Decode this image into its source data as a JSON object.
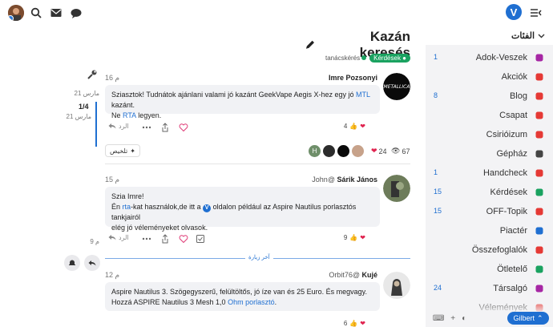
{
  "header": {
    "icons": [
      "user-avatar",
      "search-icon",
      "mail-icon",
      "chat-icon"
    ],
    "logo_letter": "V",
    "menu_icon": "menu-icon"
  },
  "topic": {
    "title": "Kazán keresés",
    "tag": "tanácskérés",
    "category": "Kérdések"
  },
  "timeline": {
    "start_date": "21 مارس",
    "position": "1/4",
    "position_date": "21 مارس",
    "end_date": "9 م"
  },
  "posts": [
    {
      "user": "Imre Pozsonyi",
      "date": "16 م",
      "text_pre": "Sziasztok! Tudnátok ajánlani valami jó kazánt GeekVape Aegis X-hez egy jó ",
      "link1": "MTL",
      "text_mid": " kazánt.",
      "text_line2_pre": "Ne ",
      "link2": "RTA",
      "text_line2_post": " legyen.",
      "reply_label": "الرد",
      "likes": "4"
    },
    {
      "user": "Sárik János",
      "handle": "John@",
      "date": "15 م",
      "line1": "Szia Imre!",
      "line2_pre": "Én ",
      "link1": "rta",
      "line2_mid": "-kat használok,de itt a ",
      "line2_post": " oldalon például az Aspire Nautilus porlasztós tankjairól",
      "line3": "elég jó véleményeket olvasok.",
      "reply_label": "الرد",
      "likes": "9"
    },
    {
      "user": "Kujé",
      "handle": "Orbit76@",
      "date": "12 م",
      "line1": "Aspire Nautilus 3. Szögegyszerű, felültöltős, jó íze van és 25 Euro. És megvagy.",
      "line2_pre": "Hozzá ASPIRE Nautilus 3 Mesh 1,0 ",
      "link1": "Ohm porlasztó",
      "line2_post": ".",
      "likes": "6"
    }
  ],
  "summary": {
    "button_label": "تلخيص",
    "likes": "24",
    "views": "67"
  },
  "last_visit_label": "آخر زيارة",
  "sidebar": {
    "heading": "الفئات",
    "items": [
      {
        "count": "1",
        "name": "Adok-Veszek",
        "color": "#a626a4"
      },
      {
        "count": "",
        "name": "Akciók",
        "color": "#e53935"
      },
      {
        "count": "8",
        "name": "Blog",
        "color": "#e53935"
      },
      {
        "count": "",
        "name": "Csapat",
        "color": "#e53935"
      },
      {
        "count": "",
        "name": "Csirióizum",
        "color": "#e53935"
      },
      {
        "count": "",
        "name": "Gépház",
        "color": "#444444"
      },
      {
        "count": "1",
        "name": "Handcheck",
        "color": "#e53935"
      },
      {
        "count": "15",
        "name": "Kérdések",
        "color": "#1aa260"
      },
      {
        "count": "15",
        "name": "OFF-Topik",
        "color": "#e53935"
      },
      {
        "count": "",
        "name": "Piactér",
        "color": "#1f6fd1"
      },
      {
        "count": "",
        "name": "Összefoglalók",
        "color": "#e53935"
      },
      {
        "count": "",
        "name": "Ötletelő",
        "color": "#1aa260"
      },
      {
        "count": "24",
        "name": "Társalgó",
        "color": "#a626a4"
      },
      {
        "count": "",
        "name": "Vélemények",
        "color": "#e53935"
      }
    ],
    "footer_user": "Gilbert"
  }
}
